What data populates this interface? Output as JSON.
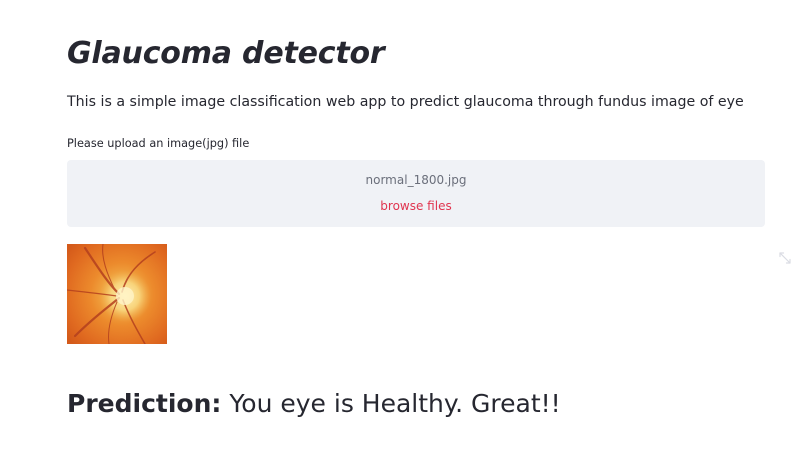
{
  "app": {
    "title": "Glaucoma detector",
    "description": "This is a simple image classification web app to predict glaucoma through fundus image of eye"
  },
  "uploader": {
    "label": "Please upload an image(jpg) file",
    "file_name": "normal_1800.jpg",
    "browse_label": "browse files"
  },
  "image": {
    "icon": "fundus-image",
    "expand_icon": "fullscreen-expand-icon"
  },
  "result": {
    "label": "Prediction:",
    "text": "You eye is Healthy. Great!!"
  },
  "colors": {
    "text": "#262730",
    "dropzone_bg": "#f0f2f6",
    "browse_link": "#e0344f",
    "file_name": "#6b6f7b"
  }
}
